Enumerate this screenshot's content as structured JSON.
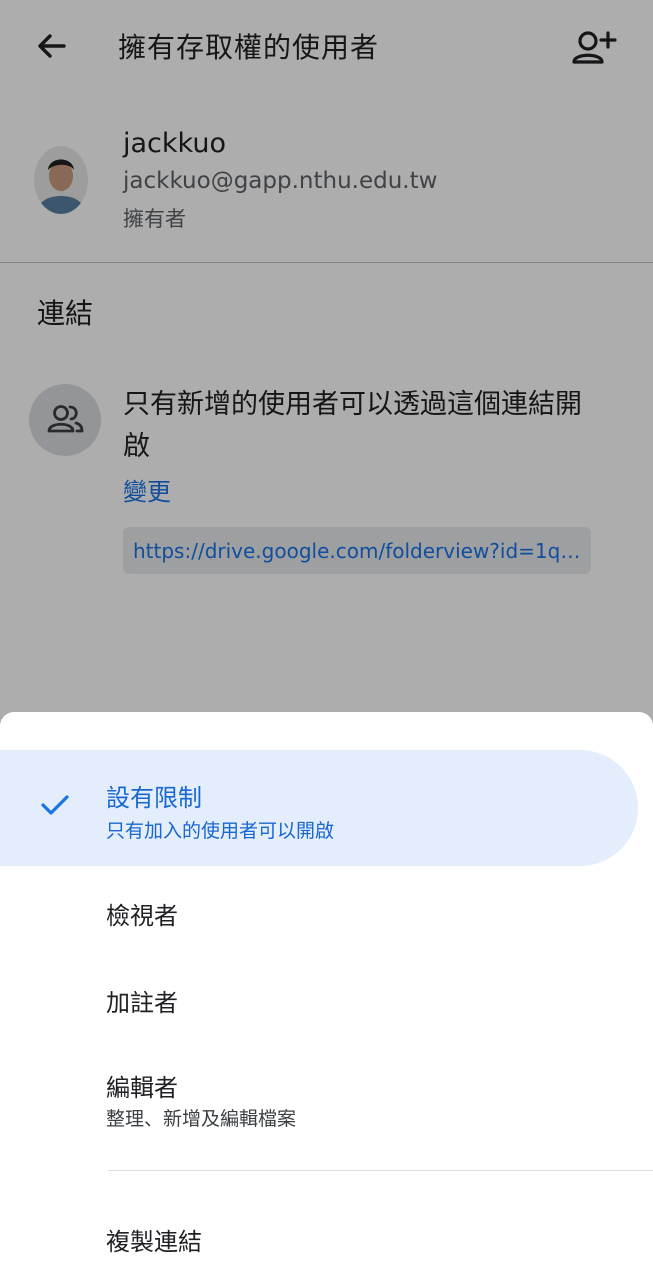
{
  "header": {
    "title": "擁有存取權的使用者"
  },
  "owner": {
    "name": "jackkuo",
    "email": "jackkuo@gapp.nthu.edu.tw",
    "role": "擁有者"
  },
  "link": {
    "section_title": "連結",
    "description": "只有新增的使用者可以透過這個連結開啟",
    "change_label": "變更",
    "url": "https://drive.google.com/folderview?id=1qIb…"
  },
  "sheet": {
    "selected": {
      "title": "設有限制",
      "subtitle": "只有加入的使用者可以開啟"
    },
    "options": [
      {
        "title": "檢視者"
      },
      {
        "title": "加註者"
      },
      {
        "title": "編輯者",
        "subtitle": "整理、新增及編輯檔案"
      }
    ],
    "copy_link": "複製連結"
  },
  "colors": {
    "accent": "#1a73e8",
    "selected_bg": "#e3edfb",
    "scrim": "rgba(0,0,0,0.32)"
  },
  "icons": {
    "back": "arrow-back-icon",
    "add_person": "person-add-icon",
    "people": "people-icon",
    "check": "check-icon"
  }
}
